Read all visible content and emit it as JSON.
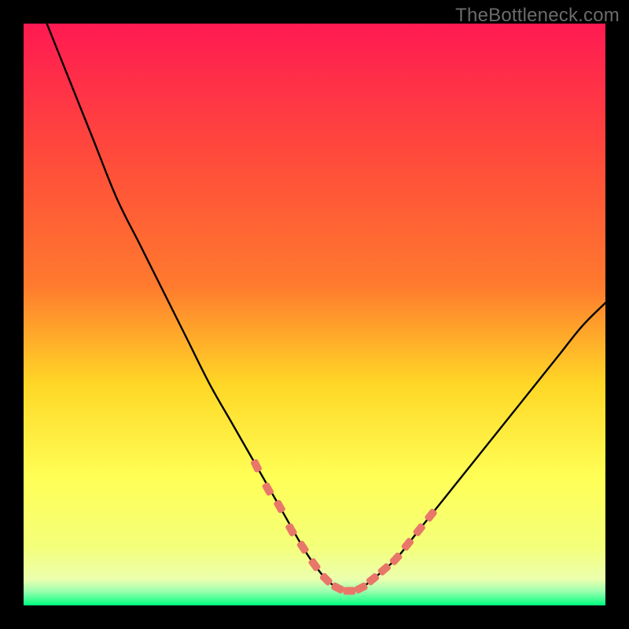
{
  "watermark": "TheBottleneck.com",
  "colors": {
    "bg_black": "#000000",
    "gradient_top": "#ff1a52",
    "gradient_mid1": "#ff7a2e",
    "gradient_mid2": "#ffd726",
    "gradient_mid3": "#ffff56",
    "gradient_mid4": "#f4ff7a",
    "gradient_bot": "#00ff7f",
    "curve": "#000000",
    "markers": "#e8776a"
  },
  "chart_data": {
    "type": "line",
    "title": "",
    "xlabel": "",
    "ylabel": "",
    "xlim": [
      0,
      100
    ],
    "ylim": [
      0,
      100
    ],
    "grid": false,
    "series": [
      {
        "name": "bottleneck-curve",
        "x": [
          4,
          8,
          12,
          16,
          20,
          24,
          28,
          32,
          36,
          40,
          44,
          48,
          50,
          52,
          54,
          56,
          58,
          60,
          64,
          68,
          72,
          76,
          80,
          84,
          88,
          92,
          96,
          100
        ],
        "y": [
          100,
          90,
          80,
          70,
          62,
          54,
          46,
          38,
          31,
          24,
          17,
          10,
          7,
          4.5,
          3,
          2.5,
          3,
          4.5,
          8,
          13,
          18,
          23,
          28,
          33,
          38,
          43,
          48,
          52
        ]
      }
    ],
    "threshold_bands": [
      {
        "y_start": 0,
        "y_end": 2.5,
        "color": "#00ff7f"
      },
      {
        "y_start": 2.5,
        "y_end": 6,
        "color": "#baff86"
      },
      {
        "y_start": 6,
        "y_end": 22,
        "color": "#ffff66"
      },
      {
        "y_start": 22,
        "y_end": 48,
        "color": "#ffd726"
      },
      {
        "y_start": 48,
        "y_end": 75,
        "color": "#ff7a2e"
      },
      {
        "y_start": 75,
        "y_end": 100,
        "color": "#ff1a52"
      }
    ],
    "markers": {
      "name": "highlighted-range",
      "points_x": [
        40,
        42,
        44,
        46,
        48,
        50,
        52,
        54,
        56,
        58,
        60,
        62,
        64,
        66,
        68,
        70
      ],
      "points_y": [
        24,
        20,
        17,
        13,
        10,
        7,
        4.5,
        3,
        2.5,
        3,
        4.5,
        6.2,
        8,
        10.5,
        13,
        15.5
      ]
    }
  }
}
